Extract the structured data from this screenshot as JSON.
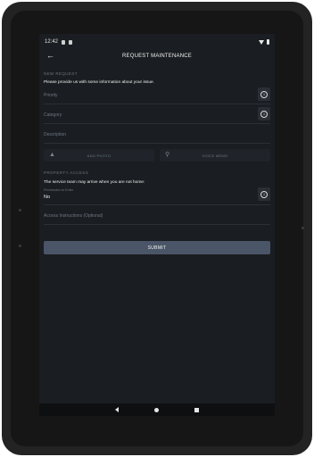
{
  "status_bar": {
    "time": "12:42"
  },
  "app_bar": {
    "title": "REQUEST MAINTENANCE"
  },
  "new_request": {
    "section_label": "NEW REQUEST",
    "intro": "Please provide us with some information about your issue.",
    "priority_placeholder": "Priority",
    "category_placeholder": "Category",
    "description_placeholder": "Description",
    "add_photo_label": "ADD PHOTO",
    "voice_memo_label": "VOICE MEMO"
  },
  "property_access": {
    "section_label": "PROPERTY ACCESS",
    "note": "The service team may arrive when you are not home:",
    "permission_label": "Permission to Enter",
    "permission_value": "No",
    "instructions_placeholder": "Access Instructions (Optional)"
  },
  "actions": {
    "submit_label": "SUBMIT"
  },
  "icons": {
    "back": "arrow-left-icon",
    "info": "info-icon",
    "photo": "image-icon",
    "mic": "microphone-icon"
  }
}
